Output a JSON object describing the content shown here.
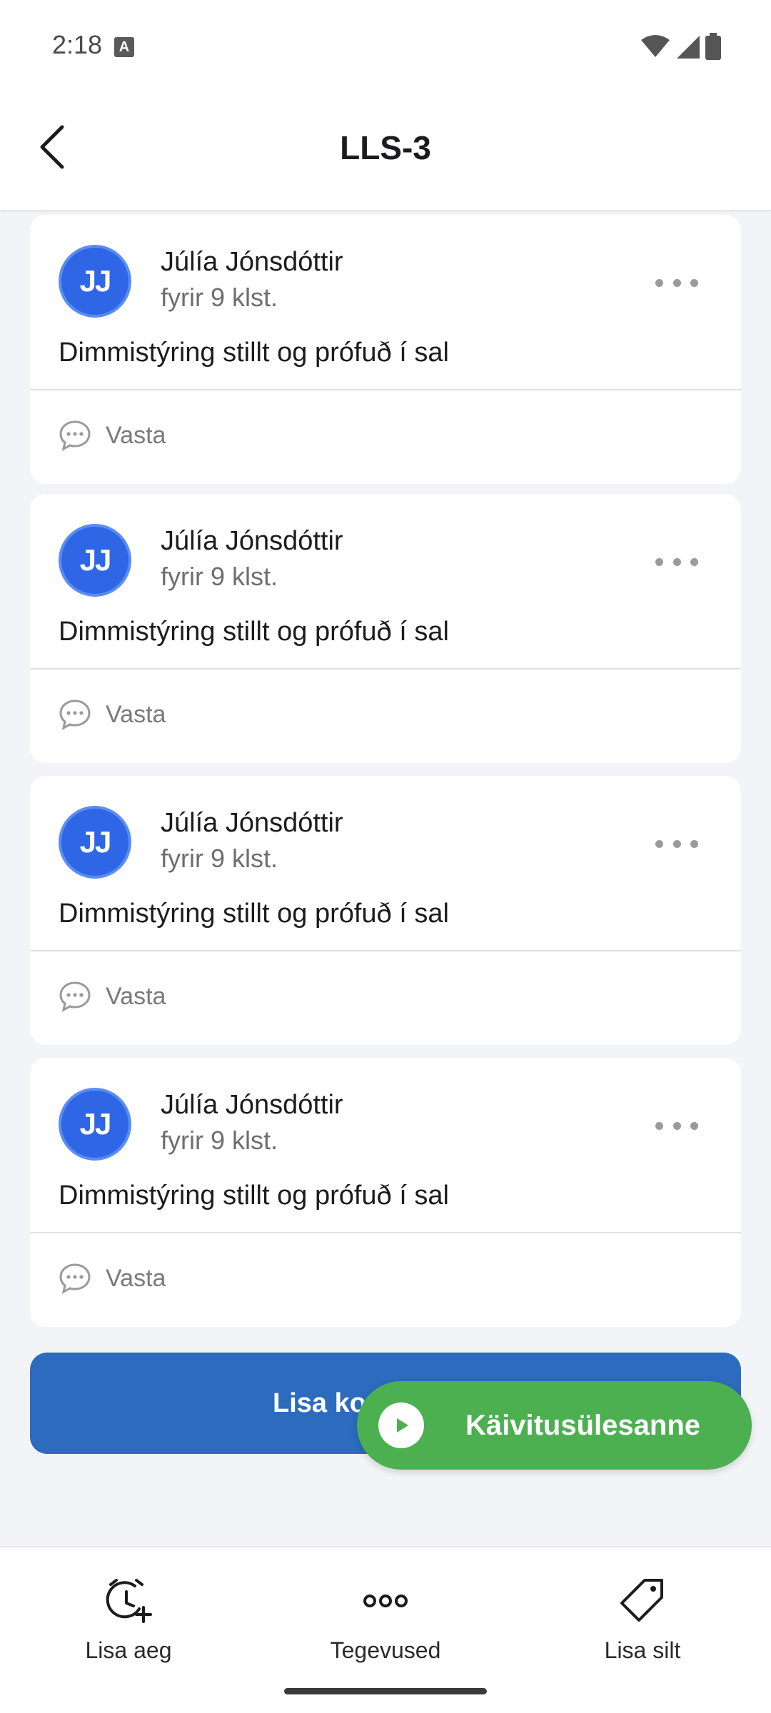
{
  "status_bar": {
    "time": "2:18",
    "indicator": "A"
  },
  "header": {
    "title": "LLS-3"
  },
  "comments": [
    {
      "initials": "JJ",
      "author": "Júlía Jónsdóttir",
      "time": "fyrir 9 klst.",
      "text": "Dimmistýring stillt og prófuð í sal",
      "reply_label": "Vasta"
    },
    {
      "initials": "JJ",
      "author": "Júlía Jónsdóttir",
      "time": "fyrir 9 klst.",
      "text": "Dimmistýring stillt og prófuð í sal",
      "reply_label": "Vasta"
    },
    {
      "initials": "JJ",
      "author": "Júlía Jónsdóttir",
      "time": "fyrir 9 klst.",
      "text": "Dimmistýring stillt og prófuð í sal",
      "reply_label": "Vasta"
    },
    {
      "initials": "JJ",
      "author": "Júlía Jónsdóttir",
      "time": "fyrir 9 klst.",
      "text": "Dimmistýring stillt og prófuð í sal",
      "reply_label": "Vasta"
    }
  ],
  "add_comment_button": {
    "label": "Lisa ko"
  },
  "run_task_button": {
    "label": "Käivitusülesanne"
  },
  "bottom_nav": [
    {
      "label": "Lisa aeg",
      "icon": "clock-plus-icon"
    },
    {
      "label": "Tegevused",
      "icon": "more-horizontal-icon"
    },
    {
      "label": "Lisa silt",
      "icon": "tag-icon"
    }
  ],
  "colors": {
    "primary_button": "#2c6bbd",
    "run_pill": "#4caf50",
    "avatar": "#2f66e6",
    "background": "#f3f4f7"
  }
}
